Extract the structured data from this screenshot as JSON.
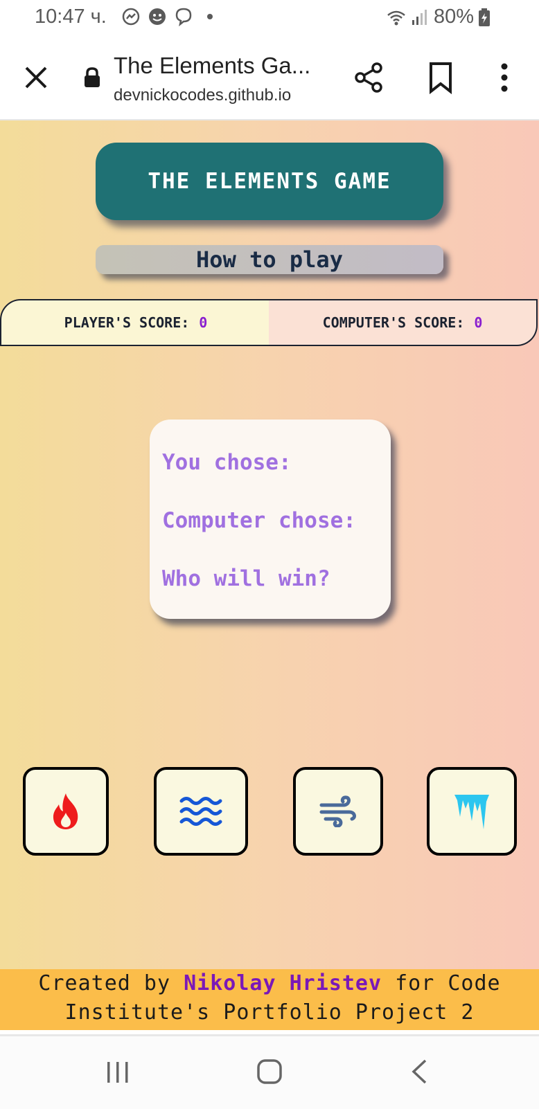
{
  "status_bar": {
    "time": "10:47 ч.",
    "battery": "80%",
    "icons": [
      "messenger-icon",
      "chat-bubble-icon",
      "viber-icon",
      "dot-icon",
      "wifi-icon",
      "signal-icon",
      "battery-icon"
    ]
  },
  "browser": {
    "tab_title": "The Elements Ga...",
    "url": "devnickocodes.github.io",
    "icons": [
      "close-icon",
      "lock-icon",
      "share-icon",
      "bookmark-icon",
      "more-vert-icon"
    ]
  },
  "game": {
    "title": "THE ELEMENTS GAME",
    "how_to_play": "How to play",
    "player_score_label": "PLAYER'S SCORE:",
    "player_score": "0",
    "computer_score_label": "COMPUTER'S SCORE:",
    "computer_score": "0",
    "result": {
      "you_chose": "You chose:",
      "computer_chose": "Computer chose:",
      "who_wins": "Who will win?"
    },
    "choices": [
      {
        "name": "fire",
        "icon": "fire-icon",
        "color": "#ee1c1c"
      },
      {
        "name": "water",
        "icon": "water-waves-icon",
        "color": "#1657d6"
      },
      {
        "name": "air",
        "icon": "wind-icon",
        "color": "#4a6a9a"
      },
      {
        "name": "ice",
        "icon": "icicle-icon",
        "color": "#2cc6ef"
      }
    ]
  },
  "footer": {
    "prefix": "Created by",
    "author": "Nikolay Hristev",
    "suffix": "for Code",
    "line2": "Institute's Portfolio Project 2"
  },
  "colors": {
    "title_bg": "#1f7174",
    "score_number": "#8a1fcf",
    "result_text": "#a070e0",
    "footer_bg": "#fbbd4a",
    "footer_author": "#7a18b8"
  }
}
